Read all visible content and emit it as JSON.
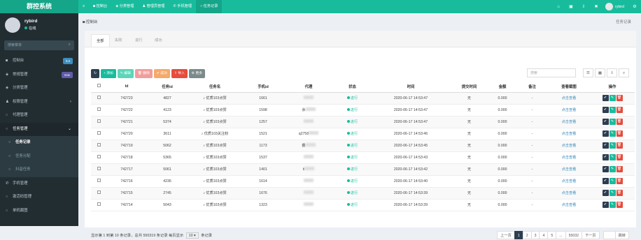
{
  "brand": "群控系统",
  "topnav": [
    {
      "icon": "≡",
      "label": ""
    },
    {
      "icon": "◙",
      "label": "控制台"
    },
    {
      "icon": "◈",
      "label": "分类管理"
    },
    {
      "icon": "♟",
      "label": "管理员管理"
    },
    {
      "icon": "✆",
      "label": "手机管理"
    },
    {
      "icon": "○",
      "label": "任务记录"
    }
  ],
  "topright": {
    "icons": [
      "⌂",
      "▣",
      "⇩",
      "✖"
    ],
    "username": "rybird"
  },
  "user": {
    "name": "rybird",
    "status": "在线"
  },
  "sidebar_search_placeholder": "搜索菜单",
  "menu": [
    {
      "icon": "◙",
      "label": "控制台",
      "badge": "hot",
      "badge_color": "#3c8dbc"
    },
    {
      "icon": "◈",
      "label": "常规管理",
      "badge": "new",
      "badge_color": "#605ca8"
    },
    {
      "icon": "◈",
      "label": "分类管理"
    },
    {
      "icon": "♟",
      "label": "权限管理",
      "chev": "‹"
    },
    {
      "icon": "○",
      "label": "代理管理"
    },
    {
      "icon": "○",
      "label": "任务管理",
      "chev": "⌄"
    },
    {
      "icon": "○",
      "label": "任务记录"
    },
    {
      "icon": "○",
      "label": "任务分配"
    },
    {
      "icon": "○",
      "label": "抖音任务"
    },
    {
      "icon": "✆",
      "label": "手机管理"
    },
    {
      "icon": "○",
      "label": "激活码管理"
    },
    {
      "icon": "○",
      "label": "单机截图"
    }
  ],
  "breadcrumb": "控制台",
  "breadcrumb_right": "任务记录",
  "tabs": [
    "全部",
    "失败",
    "进行",
    "成功"
  ],
  "toolbar": [
    {
      "icon": "↻",
      "label": "",
      "color": "#2c3e50"
    },
    {
      "icon": "+",
      "label": "添加",
      "color": "#18bc9c"
    },
    {
      "icon": "✎",
      "label": "编辑",
      "color": "#5bd6b8"
    },
    {
      "icon": "🗑",
      "label": "删除",
      "color": "#f39c9c"
    },
    {
      "icon": "✔",
      "label": "成功",
      "color": "#f5a96a"
    },
    {
      "icon": "⇪",
      "label": "导入",
      "color": "#e74c3c"
    },
    {
      "icon": "⚙",
      "label": "更多",
      "color": "#7b8a8b"
    }
  ],
  "search_placeholder": "搜索",
  "right_tools": [
    "☰",
    "▦",
    "⇩",
    "⌕"
  ],
  "columns": [
    "",
    "Id",
    "任务id",
    "任务名",
    "手机id",
    "代理",
    "状态",
    "时间",
    "提交时间",
    "金额",
    "备注",
    "查看截图",
    "操作"
  ],
  "rows": [
    {
      "id": "742723",
      "task_id": "4827",
      "name": "♪ 优质103点赞",
      "phone_id": "1661",
      "proxy": "",
      "status": "进行",
      "time": "2020-06-17 14:53:47",
      "submit": "无",
      "amount": "0.000",
      "note": "-",
      "view": "点击查看"
    },
    {
      "id": "742722",
      "task_id": "4123",
      "name": "♪ 优质103点赞",
      "phone_id": "1598",
      "proxy": "余",
      "status": "进行",
      "time": "2020-06-17 14:53:47",
      "submit": "无",
      "amount": "0.000",
      "note": "-",
      "view": "点击查看"
    },
    {
      "id": "742721",
      "task_id": "5374",
      "name": "♪ 优质103点赞",
      "phone_id": "1257",
      "proxy": "",
      "status": "进行",
      "time": "2020-06-17 14:53:47",
      "submit": "无",
      "amount": "0.000",
      "note": "-",
      "view": "点击查看"
    },
    {
      "id": "742720",
      "task_id": "3611",
      "name": "♪ 优质103关注粉",
      "phone_id": "1521",
      "proxy": "q2758",
      "status": "进行",
      "time": "2020-06-17 14:53:46",
      "submit": "无",
      "amount": "0.000",
      "note": "-",
      "view": "点击查看"
    },
    {
      "id": "742719",
      "task_id": "5062",
      "name": "♪ 优质103点赞",
      "phone_id": "1173",
      "proxy": "霸",
      "status": "进行",
      "time": "2020-06-17 14:53:45",
      "submit": "无",
      "amount": "0.000",
      "note": "-",
      "view": "点击查看"
    },
    {
      "id": "742718",
      "task_id": "5365",
      "name": "♪ 优质103点赞",
      "phone_id": "1537",
      "proxy": "",
      "status": "进行",
      "time": "2020-06-17 14:53:43",
      "submit": "无",
      "amount": "0.000",
      "note": "-",
      "view": "点击查看"
    },
    {
      "id": "742717",
      "task_id": "5061",
      "name": "♪ 优质103点赞",
      "phone_id": "1401",
      "proxy": "ti",
      "status": "进行",
      "time": "2020-06-17 14:53:42",
      "submit": "无",
      "amount": "0.000",
      "note": "-",
      "view": "点击查看"
    },
    {
      "id": "742716",
      "task_id": "4236",
      "name": "♪ 优质103点赞",
      "phone_id": "1614",
      "proxy": "",
      "status": "进行",
      "time": "2020-06-17 14:53:40",
      "submit": "无",
      "amount": "0.000",
      "note": "-",
      "view": "点击查看"
    },
    {
      "id": "742715",
      "task_id": "2745",
      "name": "♪ 优质103点赞",
      "phone_id": "1676",
      "proxy": "",
      "status": "进行",
      "time": "2020-06-17 14:53:39",
      "submit": "无",
      "amount": "0.000",
      "note": "-",
      "view": "点击查看"
    },
    {
      "id": "742714",
      "task_id": "5043",
      "name": "♪ 优质103点赞",
      "phone_id": "1323",
      "proxy": "",
      "status": "进行",
      "time": "2020-06-17 14:53:39",
      "submit": "无",
      "amount": "0.000",
      "note": "-",
      "view": "点击查看"
    }
  ],
  "footer": {
    "prefix": "显示第 1 到第 10 条记录，总共 550319 条记录 每页显示",
    "page_size": "10",
    "suffix": "条记录"
  },
  "pager": [
    "上一页",
    "1",
    "2",
    "3",
    "4",
    "5",
    "...",
    "55032",
    "下一页"
  ],
  "jump_label": "跳转",
  "colors": {
    "accent": "#18bc9c",
    "sidebar": "#222d32",
    "pager_active": "#2c3e50"
  }
}
